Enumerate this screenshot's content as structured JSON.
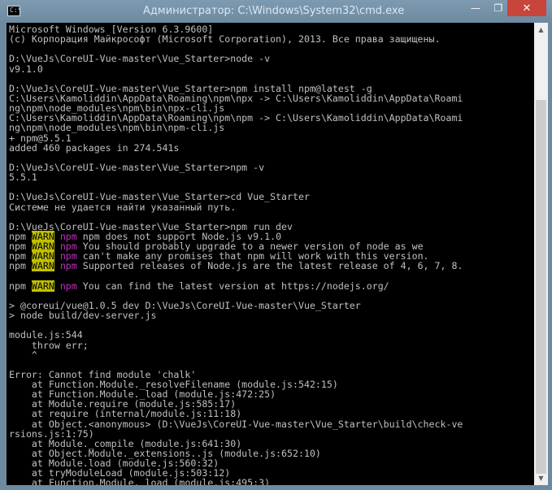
{
  "window": {
    "title": "Администратор: C:\\Windows\\System32\\cmd.exe",
    "icon_glyph": "C:\\",
    "minimize_glyph": "—",
    "maximize_glyph": "❐",
    "close_glyph": "✕",
    "colors": {
      "frame": "#6d8aa0",
      "close_button": "#c7453a",
      "console_background": "#000000",
      "console_text": "#c0c0c0",
      "warn_background": "#c0c000",
      "npm_tag": "#c030c0"
    }
  },
  "scrollbar": {
    "up_glyph": "▲",
    "down_glyph": "▼"
  },
  "console": {
    "lines": [
      "Microsoft Windows [Version 6.3.9600]",
      "(c) Корпорация Майкрософт (Microsoft Corporation), 2013. Все права защищены.",
      "",
      "D:\\VueJs\\CoreUI-Vue-master\\Vue_Starter>node -v",
      "v9.1.0",
      "",
      "D:\\VueJs\\CoreUI-Vue-master\\Vue_Starter>npm install npm@latest -g",
      "C:\\Users\\Kamoliddin\\AppData\\Roaming\\npm\\npx -> C:\\Users\\Kamoliddin\\AppData\\Roami",
      "ng\\npm\\node_modules\\npm\\bin\\npx-cli.js",
      "C:\\Users\\Kamoliddin\\AppData\\Roaming\\npm\\npm -> C:\\Users\\Kamoliddin\\AppData\\Roami",
      "ng\\npm\\node_modules\\npm\\bin\\npm-cli.js",
      "+ npm@5.5.1",
      "added 460 packages in 274.541s",
      "",
      "D:\\VueJs\\CoreUI-Vue-master\\Vue_Starter>npm -v",
      "5.5.1",
      "",
      "D:\\VueJs\\CoreUI-Vue-master\\Vue_Starter>cd Vue_Starter",
      "Системе не удается найти указанный путь.",
      "",
      "D:\\VueJs\\CoreUI-Vue-master\\Vue_Starter>npm run dev",
      {
        "p": "npm ",
        "w": "WARN",
        "t": " npm",
        "m": " npm does not support Node.js v9.1.0"
      },
      {
        "p": "npm ",
        "w": "WARN",
        "t": " npm",
        "m": " You should probably upgrade to a newer version of node as we"
      },
      {
        "p": "npm ",
        "w": "WARN",
        "t": " npm",
        "m": " can't make any promises that npm will work with this version."
      },
      {
        "p": "npm ",
        "w": "WARN",
        "t": " npm",
        "m": " Supported releases of Node.js are the latest release of 4, 6, 7, 8."
      },
      "",
      {
        "p": "npm ",
        "w": "WARN",
        "t": " npm",
        "m": " You can find the latest version at https://nodejs.org/"
      },
      "",
      "> @coreui/vue@1.0.5 dev D:\\VueJs\\CoreUI-Vue-master\\Vue_Starter",
      "> node build/dev-server.js",
      "",
      "module.js:544",
      "    throw err;",
      "    ^",
      "",
      "Error: Cannot find module 'chalk'",
      "    at Function.Module._resolveFilename (module.js:542:15)",
      "    at Function.Module._load (module.js:472:25)",
      "    at Module.require (module.js:585:17)",
      "    at require (internal/module.js:11:18)",
      "    at Object.<anonymous> (D:\\VueJs\\CoreUI-Vue-master\\Vue_Starter\\build\\check-ve",
      "rsions.js:1:75)",
      "    at Module._compile (module.js:641:30)",
      "    at Object.Module._extensions..js (module.js:652:10)",
      "    at Module.load (module.js:560:32)",
      "    at tryModuleLoad (module.js:503:12)",
      "    at Function.Module._load (module.js:495:3)"
    ]
  }
}
